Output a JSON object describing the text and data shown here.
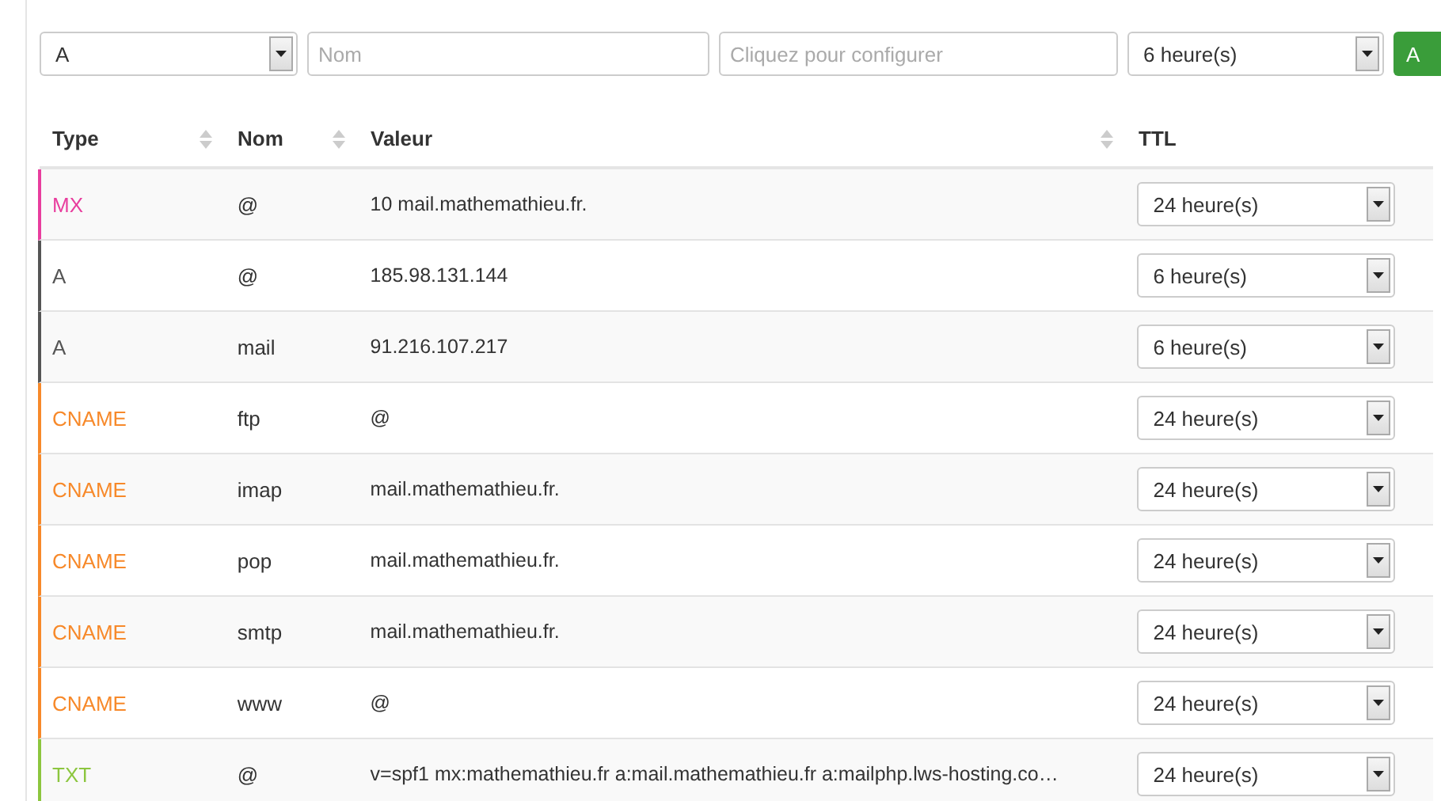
{
  "form": {
    "type_select": "A",
    "name_placeholder": "Nom",
    "value_placeholder": "Cliquez pour configurer",
    "ttl_select": "6 heure(s)",
    "add_button": "A"
  },
  "table": {
    "columns": [
      {
        "label": "Type",
        "sortable": true
      },
      {
        "label": "Nom",
        "sortable": true
      },
      {
        "label": "Valeur",
        "sortable": true
      },
      {
        "label": "TTL",
        "sortable": false
      }
    ],
    "rows": [
      {
        "type": "MX",
        "color": "#e83e9e",
        "name": "@",
        "value": "10 mail.mathemathieu.fr.",
        "ttl": "24 heure(s)"
      },
      {
        "type": "A",
        "color": "#555555",
        "name": "@",
        "value": "185.98.131.144",
        "ttl": "6 heure(s)"
      },
      {
        "type": "A",
        "color": "#555555",
        "name": "mail",
        "value": "91.216.107.217",
        "ttl": "6 heure(s)"
      },
      {
        "type": "CNAME",
        "color": "#f7892a",
        "name": "ftp",
        "value": "@",
        "ttl": "24 heure(s)"
      },
      {
        "type": "CNAME",
        "color": "#f7892a",
        "name": "imap",
        "value": "mail.mathemathieu.fr.",
        "ttl": "24 heure(s)"
      },
      {
        "type": "CNAME",
        "color": "#f7892a",
        "name": "pop",
        "value": "mail.mathemathieu.fr.",
        "ttl": "24 heure(s)"
      },
      {
        "type": "CNAME",
        "color": "#f7892a",
        "name": "smtp",
        "value": "mail.mathemathieu.fr.",
        "ttl": "24 heure(s)"
      },
      {
        "type": "CNAME",
        "color": "#f7892a",
        "name": "www",
        "value": "@",
        "ttl": "24 heure(s)"
      },
      {
        "type": "TXT",
        "color": "#8cc63f",
        "name": "@",
        "value": "v=spf1 mx:mathemathieu.fr a:mail.mathemathieu.fr a:mailphp.lws-hosting.co…",
        "ttl": "24 heure(s)"
      }
    ]
  }
}
